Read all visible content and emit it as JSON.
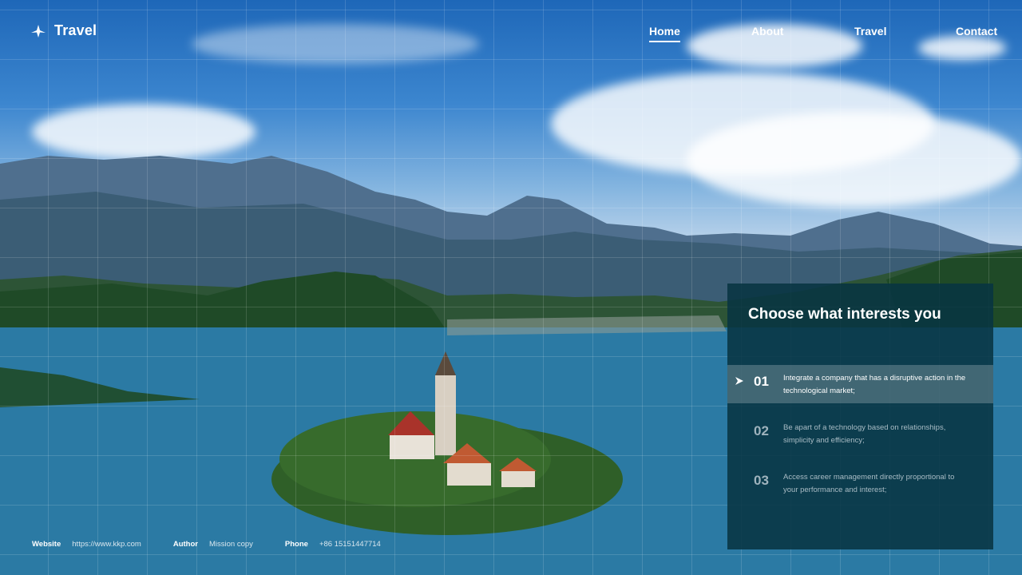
{
  "brand": {
    "name": "Travel",
    "icon": "plane-icon"
  },
  "nav": {
    "items": [
      {
        "label": "Home",
        "active": true
      },
      {
        "label": "About",
        "active": false
      },
      {
        "label": "Travel",
        "active": false
      },
      {
        "label": "Contact",
        "active": false
      }
    ]
  },
  "panel": {
    "title": "Choose what interests you",
    "items": [
      {
        "num": "01",
        "text": "Integrate a company that has a disruptive action in the technological market;",
        "active": true
      },
      {
        "num": "02",
        "text": "Be apart of a technology based on relationships, simplicity and efficiency;",
        "active": false
      },
      {
        "num": "03",
        "text": "Access career management directly proportional to your performance and interest;",
        "active": false
      }
    ]
  },
  "footer": {
    "website_label": "Website",
    "website_value": "https://www.kkp.com",
    "author_label": "Author",
    "author_value": "Mission copy",
    "phone_label": "Phone",
    "phone_value": "+86 15151447714"
  },
  "colors": {
    "panel_bg": "#083442",
    "accent": "#ffffff",
    "lake": "#2b7aa4",
    "sky": "#3c86cf"
  }
}
